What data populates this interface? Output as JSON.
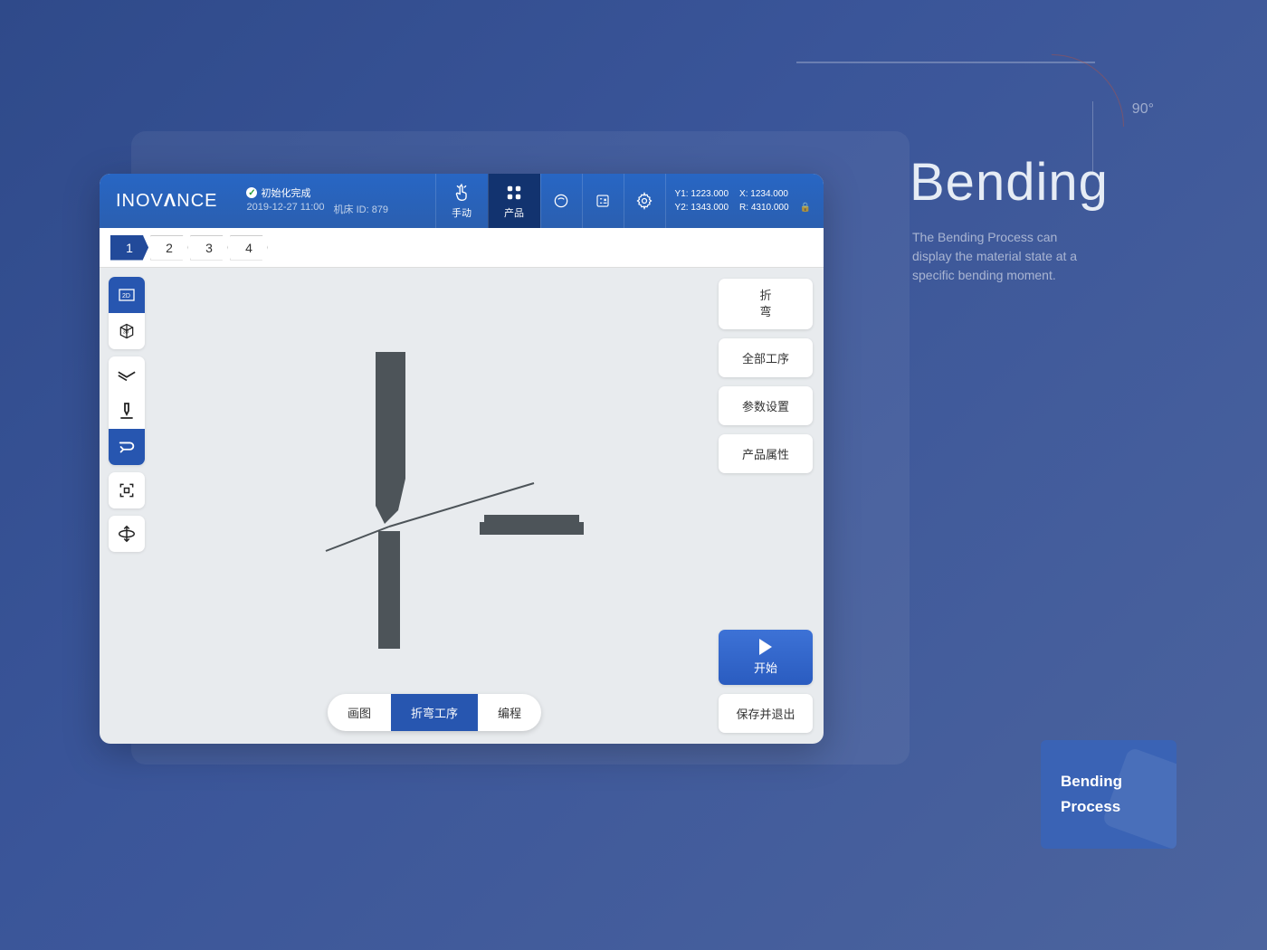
{
  "decor": {
    "angle": "90°",
    "title": "Bending",
    "desc": "The Bending Process can display the material state at a specific bending moment."
  },
  "badge": {
    "line1": "Bending",
    "line2": "Process"
  },
  "header": {
    "brand_prefix": "INOV",
    "brand_mid": "Λ",
    "brand_suffix": "NCE",
    "status": "初始化完成",
    "datetime": "2019-12-27 11:00",
    "machine_id": "机床 ID: 879"
  },
  "nav": {
    "manual": "手动",
    "product": "产品",
    "coords": {
      "y1": "Y1: 1223.000",
      "x": "X: 1234.000",
      "y2": "Y2: 1343.000",
      "r": "R: 4310.000"
    }
  },
  "steps": [
    "1",
    "2",
    "3",
    "4"
  ],
  "right_buttons": {
    "bend": "折\n弯",
    "all_steps": "全部工序",
    "params": "参数设置",
    "props": "产品属性",
    "start": "开始",
    "save_exit": "保存并退出"
  },
  "bottom": {
    "draw": "画图",
    "bend_proc": "折弯工序",
    "program": "编程"
  }
}
